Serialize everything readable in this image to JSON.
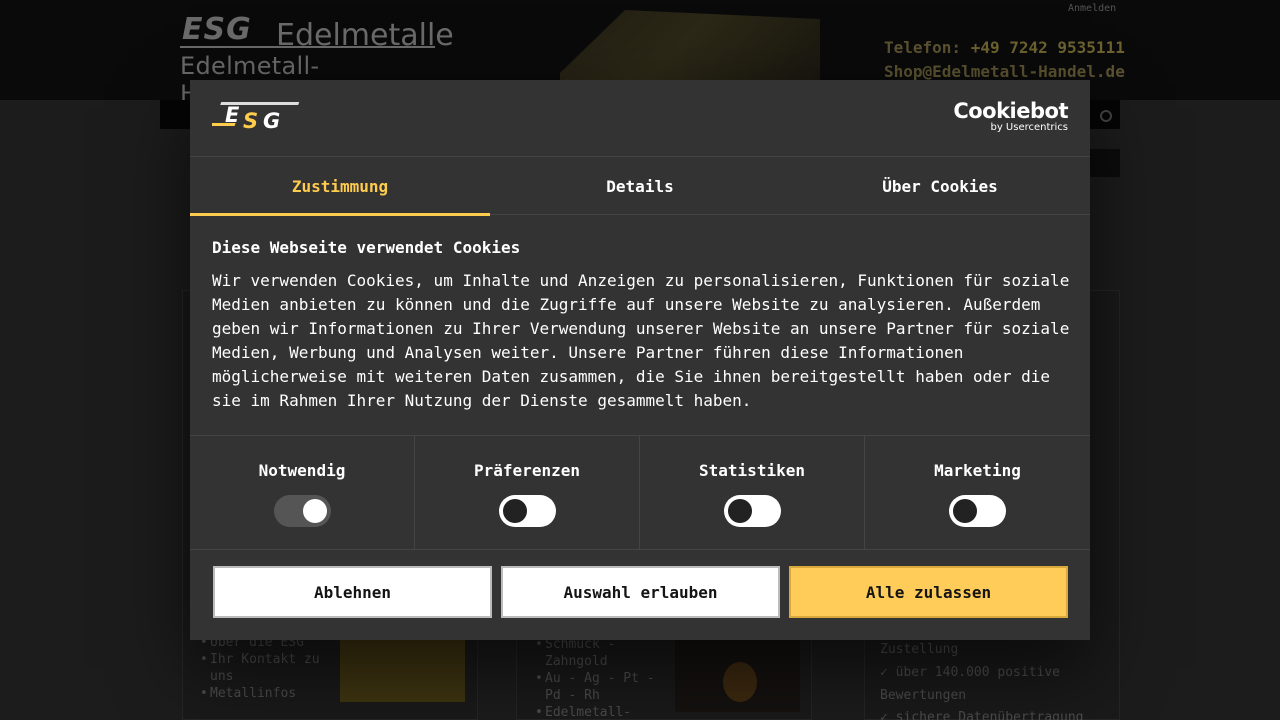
{
  "background_page": {
    "logo_esg": "ESG",
    "logo_name": "Edelmetalle",
    "logo_domain": "Edelmetall-Handel.de",
    "login_link": "Anmelden",
    "phone_label": "Telefon:",
    "phone_number": "+49 7242 9535111",
    "email": "Shop@Edelmetall-Handel.de",
    "left_list": [
      "Über die ESG",
      "Ihr Kontakt zu uns",
      "Metallinfos"
    ],
    "middle_list": [
      "Schmuck - Zahngold",
      "Au - Ag - Pt - Pd - Rh",
      "Edelmetall-"
    ],
    "right_text": [
      "Zustellung",
      "✓ über 140.000 positive",
      "Bewertungen",
      "✓ sichere Datenübertragung"
    ]
  },
  "dialog": {
    "logo_text": "ESG",
    "brand_name": "Cookiebot",
    "brand_sub": "by Usercentrics",
    "tabs": [
      {
        "label": "Zustimmung",
        "active": true
      },
      {
        "label": "Details",
        "active": false
      },
      {
        "label": "Über Cookies",
        "active": false
      }
    ],
    "title": "Diese Webseite verwendet Cookies",
    "text": "Wir verwenden Cookies, um Inhalte und Anzeigen zu personalisieren, Funktionen für soziale Medien anbieten zu können und die Zugriffe auf unsere Website zu analysieren. Außerdem geben wir Informationen zu Ihrer Verwendung unserer Website an unsere Partner für soziale Medien, Werbung und Analysen weiter. Unsere Partner führen diese Informationen möglicherweise mit weiteren Daten zusammen, die Sie ihnen bereitgestellt haben oder die sie im Rahmen Ihrer Nutzung der Dienste gesammelt haben.",
    "categories": [
      {
        "label": "Notwendig",
        "enabled": true
      },
      {
        "label": "Präferenzen",
        "enabled": false
      },
      {
        "label": "Statistiken",
        "enabled": false
      },
      {
        "label": "Marketing",
        "enabled": false
      }
    ],
    "buttons": {
      "reject": "Ablehnen",
      "allow_selection": "Auswahl erlauben",
      "allow_all": "Alle zulassen"
    },
    "accent_color": "#ffcc4d"
  }
}
